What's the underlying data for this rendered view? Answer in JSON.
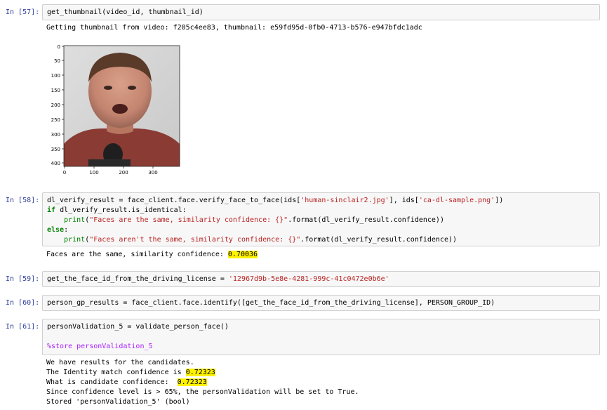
{
  "cells": {
    "c57": {
      "prompt": "In [57]:",
      "code": [
        "get_thumbnail(video_id, thumbnail_id)"
      ],
      "output": "Getting thumbnail from video: f205c4ee83, thumbnail: e59fd95d-0fb0-4713-b576-e947bfdc1adc"
    },
    "c58": {
      "prompt": "In [58]:",
      "line1_a": "dl_verify_result = face_client.face.verify_face_to_face(ids[",
      "line1_s1": "'human-sinclair2.jpg'",
      "line1_b": "], ids[",
      "line1_s2": "'ca-dl-sample.png'",
      "line1_c": "])",
      "line2_kw": "if",
      "line2_rest": " dl_verify_result.is_identical:",
      "line3_fn": "print",
      "line3_a": "(",
      "line3_s": "\"Faces are the same, similarity confidence: {}\"",
      "line3_b": ".format(dl_verify_result.confidence))",
      "line4_kw": "else",
      "line4_rest": ":",
      "line5_fn": "print",
      "line5_a": "(",
      "line5_s": "\"Faces aren't the same, similarity confidence: {}\"",
      "line5_b": ".format(dl_verify_result.confidence))",
      "output_text": "Faces are the same, similarity confidence: ",
      "output_value": "0.70036"
    },
    "c59": {
      "prompt": "In [59]:",
      "code_a": "get_the_face_id_from_the_driving_license = ",
      "code_s": "'12967d9b-5e8e-4281-999c-41c0472e0b6e'"
    },
    "c60": {
      "prompt": "In [60]:",
      "code": "person_gp_results = face_client.face.identify([get_the_face_id_from_the_driving_license], PERSON_GROUP_ID)"
    },
    "c61": {
      "prompt": "In [61]:",
      "code_line1": "personValidation_5 = validate_person_face()",
      "code_line2": "%store personValidation_5",
      "out1": "We have results for the candidates.",
      "out2_text": "The Identity match confidence is ",
      "out2_value": "0.72323",
      "out3_text": "What is candidate confidence:  ",
      "out3_value": "0.72323",
      "out4": "Since confidence level is > 65%, the personValidation will be set to True.",
      "out5": "Stored 'personValidation_5' (bool)"
    }
  },
  "thumbnail": {
    "y_ticks": [
      "0",
      "50",
      "100",
      "150",
      "200",
      "250",
      "300",
      "350",
      "400"
    ],
    "x_ticks": [
      "0",
      "100",
      "200",
      "300"
    ]
  },
  "colors": {
    "prompt": "#303f9f",
    "highlight": "#fff200",
    "keyword": "#008000",
    "string": "#ba2121"
  }
}
